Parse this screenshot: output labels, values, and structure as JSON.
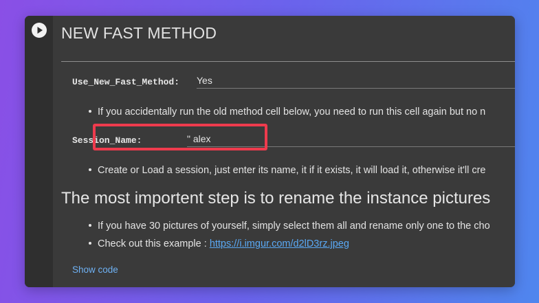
{
  "cell": {
    "title": "NEW FAST METHOD",
    "run_button_icon": "play-icon",
    "params": {
      "fast_method": {
        "label": "Use_New_Fast_Method:",
        "value": "Yes"
      },
      "session_name": {
        "label": "Session_Name:",
        "value": "\" alex"
      }
    },
    "bullets": {
      "accident_note": "If you accidentally run the old method cell below, you need to run this cell again but no n",
      "session_note": "Create or Load a session, just enter its name, it if it exists, it will load it, otherwise it'll cre",
      "rename_note": "If you have 30 pictures of yourself, simply select them all and rename only one to the cho",
      "example_prefix": "Check out this example : ",
      "example_link": "https://i.imgur.com/d2lD3rz.jpeg"
    },
    "heading": "The most importent step is to rename the instance pictures",
    "show_code": "Show code"
  },
  "colors": {
    "highlight": "#ee3b4d",
    "link": "#5aa9f5",
    "cell_bg": "#3a3a3a"
  }
}
